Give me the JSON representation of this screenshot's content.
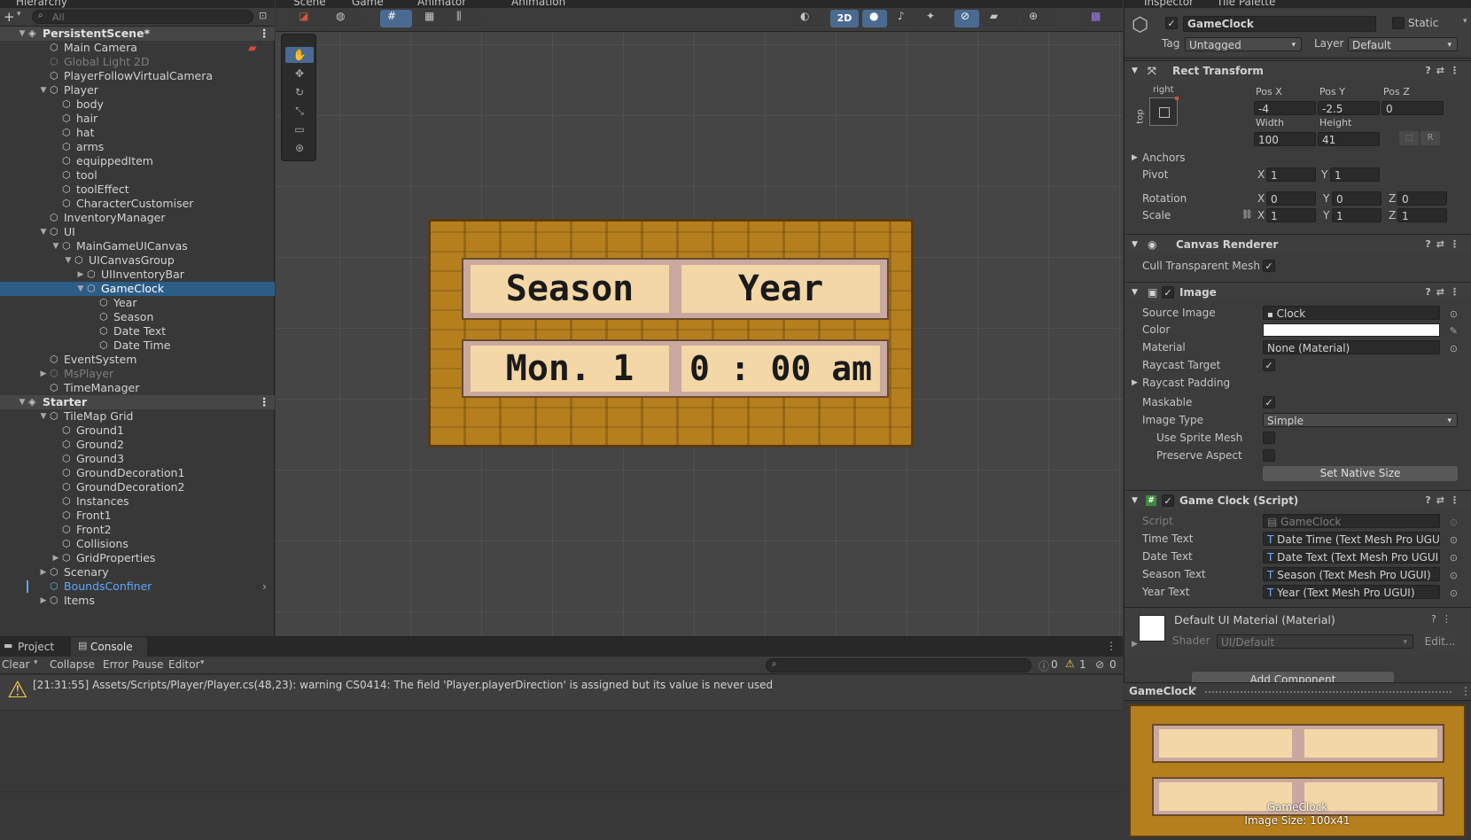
{
  "tabs": {
    "hierarchy": "Hierarchy",
    "scene": "Scene",
    "game": "Game",
    "animator": "Animator",
    "animation": "Animation",
    "inspector": "Inspector",
    "tile_palette": "Tile Palette"
  },
  "hierarchy": {
    "search_placeholder": "All",
    "rows": [
      {
        "label": "PersistentScene*",
        "type": "scene"
      },
      {
        "label": "Main Camera"
      },
      {
        "label": "Global Light 2D",
        "dim": true
      },
      {
        "label": "PlayerFollowVirtualCamera"
      },
      {
        "label": "Player",
        "expand": "down"
      },
      {
        "label": "body"
      },
      {
        "label": "hair"
      },
      {
        "label": "hat"
      },
      {
        "label": "arms"
      },
      {
        "label": "equippedItem"
      },
      {
        "label": "tool"
      },
      {
        "label": "toolEffect"
      },
      {
        "label": "CharacterCustomiser"
      },
      {
        "label": "InventoryManager"
      },
      {
        "label": "UI",
        "expand": "down"
      },
      {
        "label": "MainGameUICanvas",
        "expand": "down"
      },
      {
        "label": "UICanvasGroup",
        "expand": "down"
      },
      {
        "label": "UIInventoryBar",
        "expand": "right"
      },
      {
        "label": "GameClock",
        "expand": "down",
        "selected": true
      },
      {
        "label": "Year"
      },
      {
        "label": "Season"
      },
      {
        "label": "Date Text"
      },
      {
        "label": "Date Time"
      },
      {
        "label": "EventSystem"
      },
      {
        "label": "MsPlayer",
        "dim": true,
        "expand": "right"
      },
      {
        "label": "TimeManager"
      },
      {
        "label": "Starter",
        "type": "scene"
      },
      {
        "label": "TileMap Grid",
        "expand": "down"
      },
      {
        "label": "Ground1"
      },
      {
        "label": "Ground2"
      },
      {
        "label": "Ground3"
      },
      {
        "label": "GroundDecoration1"
      },
      {
        "label": "GroundDecoration2"
      },
      {
        "label": "Instances"
      },
      {
        "label": "Front1"
      },
      {
        "label": "Front2"
      },
      {
        "label": "Collisions"
      },
      {
        "label": "GridProperties",
        "expand": "right"
      },
      {
        "label": "Scenary",
        "expand": "right"
      },
      {
        "label": "BoundsConfiner",
        "blue": true
      },
      {
        "label": "Items",
        "expand": "right"
      }
    ]
  },
  "scene": {
    "toggle_2d": "2D",
    "clock": {
      "season": "Season",
      "year": "Year",
      "date": "Mon. 1",
      "time": "0 : 00 am"
    }
  },
  "inspector": {
    "object_name": "GameClock",
    "static_label": "Static",
    "tag_label": "Tag",
    "tag_value": "Untagged",
    "layer_label": "Layer",
    "layer_value": "Default",
    "rect_transform": {
      "title": "Rect Transform",
      "anchor_h": "right",
      "anchor_v": "top",
      "pos_x_label": "Pos X",
      "pos_x": "-4",
      "pos_y_label": "Pos Y",
      "pos_y": "-2.5",
      "pos_z_label": "Pos Z",
      "pos_z": "0",
      "width_label": "Width",
      "width": "100",
      "height_label": "Height",
      "height": "41",
      "r_label": "R",
      "anchors_label": "Anchors",
      "pivot_label": "Pivot",
      "pivot_x": "1",
      "pivot_y": "1",
      "rotation_label": "Rotation",
      "rot_x": "0",
      "rot_y": "0",
      "rot_z": "0",
      "scale_label": "Scale",
      "scale_x": "1",
      "scale_y": "1",
      "scale_z": "1",
      "x": "X",
      "y": "Y",
      "z": "Z"
    },
    "canvas_renderer": {
      "title": "Canvas Renderer",
      "cull_label": "Cull Transparent Mesh"
    },
    "image": {
      "title": "Image",
      "source_label": "Source Image",
      "source_value": "Clock",
      "color_label": "Color",
      "material_label": "Material",
      "material_value": "None (Material)",
      "raycast_label": "Raycast Target",
      "raycast_padding_label": "Raycast Padding",
      "maskable_label": "Maskable",
      "image_type_label": "Image Type",
      "image_type_value": "Simple",
      "use_sprite_mesh_label": "Use Sprite Mesh",
      "preserve_aspect_label": "Preserve Aspect",
      "native_size_button": "Set Native Size"
    },
    "game_clock_script": {
      "title": "Game Clock (Script)",
      "script_label": "Script",
      "script_value": "GameClock",
      "time_text_label": "Time Text",
      "time_text_value": "Date Time (Text Mesh Pro UGUI)",
      "date_text_label": "Date Text",
      "date_text_value": "Date Text (Text Mesh Pro UGUI)",
      "season_text_label": "Season Text",
      "season_text_value": "Season (Text Mesh Pro UGUI)",
      "year_text_label": "Year Text",
      "year_text_value": "Year (Text Mesh Pro UGUI)"
    },
    "material_section": {
      "title": "Default UI Material (Material)",
      "shader_label": "Shader",
      "shader_value": "UI/Default",
      "edit_button": "Edit..."
    },
    "add_component": "Add Component"
  },
  "bottom": {
    "project_tab": "Project",
    "console_tab": "Console",
    "clear": "Clear",
    "collapse": "Collapse",
    "error_pause": "Error Pause",
    "editor": "Editor",
    "log_count": "0",
    "warn_count": "1",
    "error_count": "0",
    "message": "[21:31:55] Assets/Scripts/Player/Player.cs(48,23): warning CS0414: The field 'Player.playerDirection' is assigned but its value is never used"
  },
  "preview": {
    "title": "GameClock",
    "name": "GameClock",
    "size": "Image Size: 100x41"
  },
  "colors": {
    "selection": "#2c5d87",
    "wood": "#b98320",
    "wood_dark": "#5a3b10",
    "parchment": "#f3d7a6",
    "accent_blue": "#4a6a91"
  }
}
